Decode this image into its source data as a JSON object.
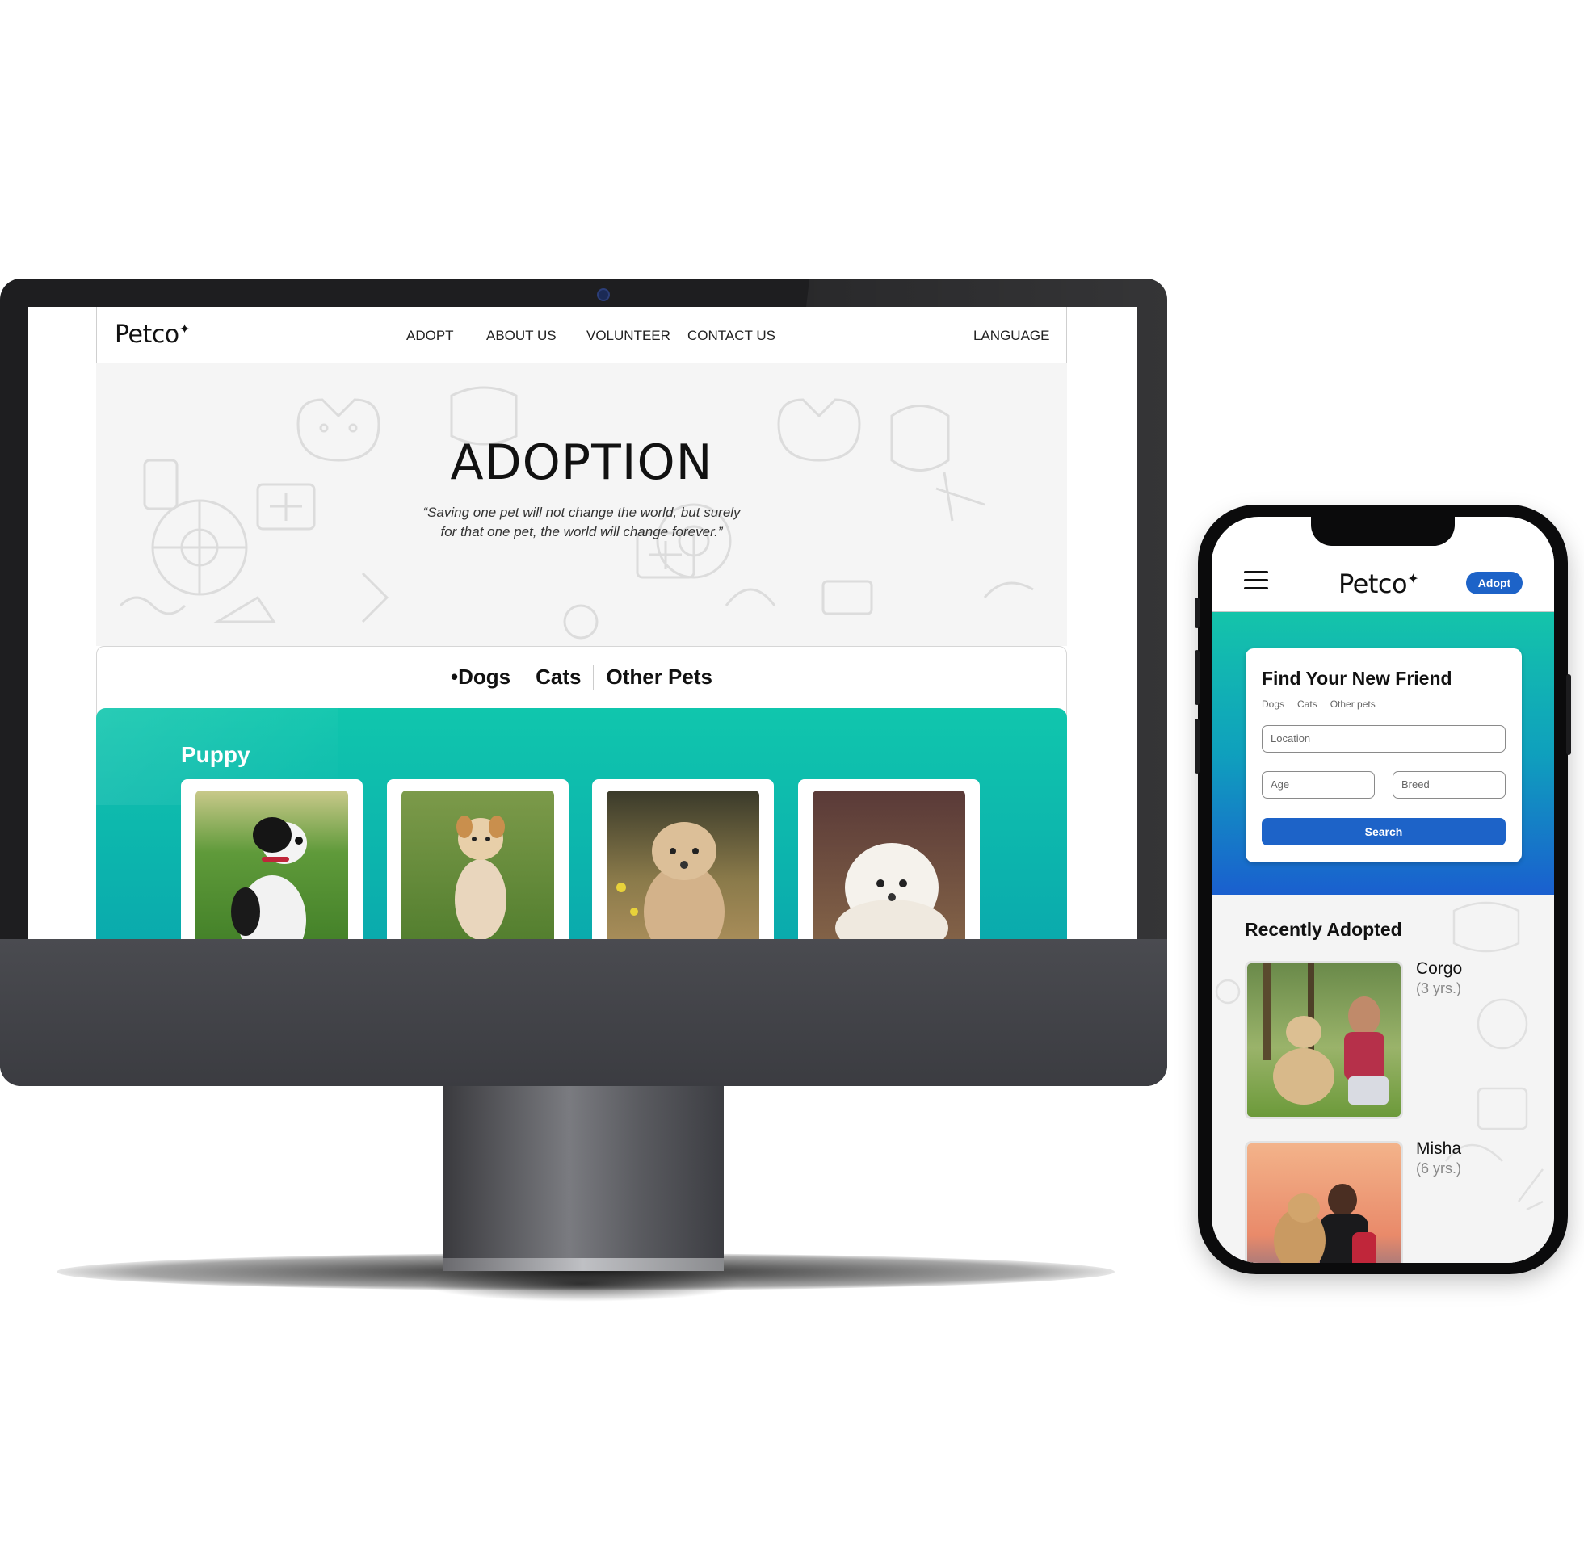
{
  "desktop": {
    "logo": "Petco",
    "nav": {
      "adopt": "ADOPT",
      "about": "ABOUT US",
      "volunteer": "VOLUNTEER",
      "contact": "CONTACT US",
      "language": "LANGUAGE"
    },
    "hero": {
      "title": "ADOPTION",
      "quote": "“Saving one pet will not change the world, but surely for that one pet, the world will change forever.”"
    },
    "tabs": [
      "•Dogs",
      "Cats",
      "Other Pets"
    ],
    "section_title": "Puppy"
  },
  "mobile": {
    "logo": "Petco",
    "adopt_button": "Adopt",
    "search_card": {
      "title": "Find Your New Friend",
      "tabs": [
        "Dogs",
        "Cats",
        "Other pets"
      ],
      "location_placeholder": "Location",
      "age_placeholder": "Age",
      "breed_placeholder": "Breed",
      "search_button": "Search"
    },
    "recently_adopted": {
      "title": "Recently Adopted",
      "items": [
        {
          "name": "Corgo",
          "age": "(3 yrs.)"
        },
        {
          "name": "Misha",
          "age": "(6 yrs.)"
        }
      ]
    }
  },
  "colors": {
    "teal": "#10c6ad",
    "blue": "#1d63c8",
    "device_dark": "#1e1e20"
  }
}
